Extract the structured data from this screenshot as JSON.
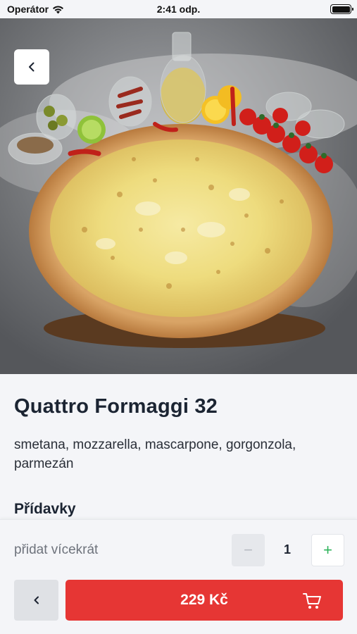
{
  "status_bar": {
    "carrier": "Operátor",
    "time": "2:41 odp.",
    "icons": [
      "wifi-icon",
      "battery-icon"
    ]
  },
  "hero": {
    "image": "pizza-photo",
    "back_icon": "chevron-left-icon"
  },
  "product": {
    "name": "Quattro Formaggi 32",
    "description": "smetana, mozzarella, mascarpone, gorgonzola, parmezán",
    "addons_heading": "Přídavky"
  },
  "order": {
    "multi_label": "přidat vícekrát",
    "minus": "−",
    "quantity": "1",
    "plus": "+",
    "prev_icon": "chevron-left-icon",
    "price": "229 Kč",
    "cart_icon": "cart-icon"
  },
  "colors": {
    "accent_red": "#e63634",
    "plus_green": "#2db35a",
    "title_navy": "#1b2432"
  }
}
